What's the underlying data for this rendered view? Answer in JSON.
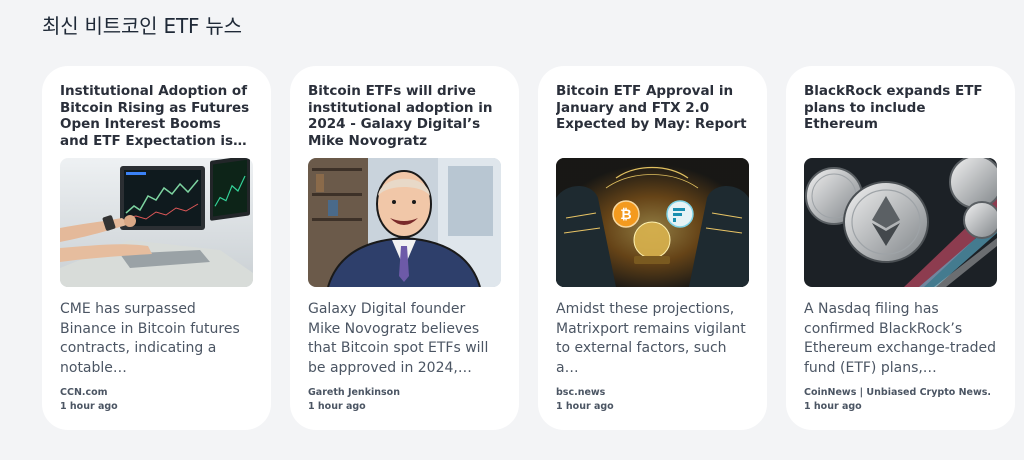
{
  "section": {
    "title": "최신 비트코인 ETF 뉴스"
  },
  "articles": [
    {
      "title": "Institutional Adoption of Bitcoin Rising as Futures Open Interest Booms and ETF Expectation is…",
      "description": "CME has surpassed Binance in Bitcoin futures contracts, indicating a notable…",
      "source": "CCN.com",
      "time": "1 hour ago",
      "image": "trading-laptop"
    },
    {
      "title": "Bitcoin ETFs will drive institutional adoption in 2024 - Galaxy Digital’s Mike Novogratz",
      "description": "Galaxy Digital founder Mike Novogratz believes that Bitcoin spot ETFs will be approved in 2024,…",
      "source": "Gareth Jenkinson",
      "time": "1 hour ago",
      "image": "portrait-illustration"
    },
    {
      "title": "Bitcoin ETF Approval in January and FTX 2.0 Expected by May: Report",
      "description": "Amidst these projections, Matrixport remains vigilant to external factors, such a…",
      "source": "bsc.news",
      "time": "1 hour ago",
      "image": "crystal-ball-illustration"
    },
    {
      "title": "BlackRock expands ETF plans to include Ethereum",
      "description": "A Nasdaq filing has confirmed BlackRock’s Ethereum exchange-traded fund (ETF) plans,…",
      "source": "CoinNews | Unbiased Crypto News.",
      "time": "1 hour ago",
      "image": "ethereum-coins"
    }
  ]
}
